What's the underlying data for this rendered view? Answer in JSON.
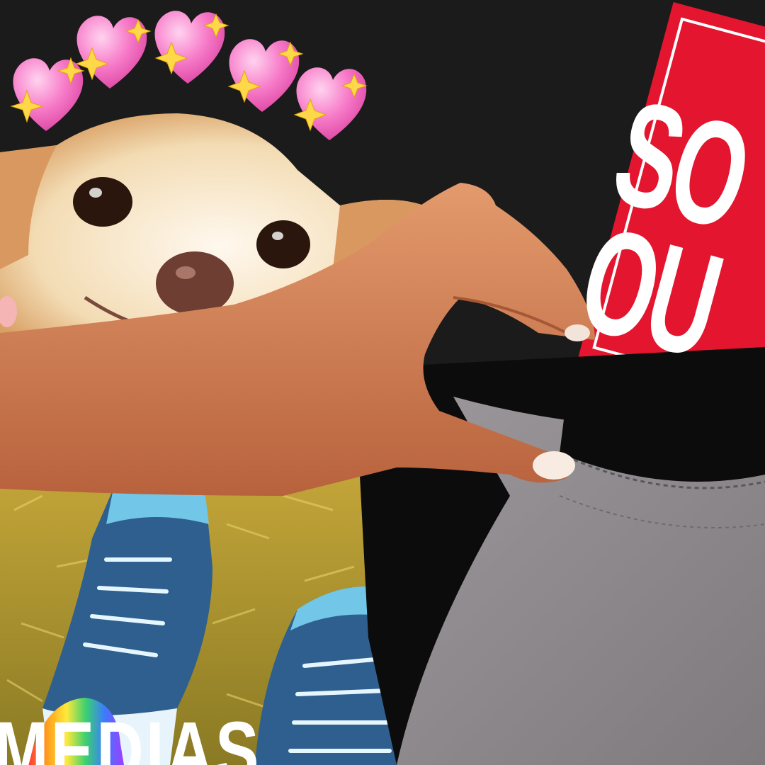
{
  "image": {
    "caption_text": "MEDIAS",
    "sign_text_lines": [
      "SO",
      "OU"
    ],
    "colors": {
      "background": "#1b1b1b",
      "sign_red": "#e4152e",
      "shirt_gray": "#8e8a8e",
      "shirt_black": "#0c0c0c",
      "grass": "#b59a2c",
      "sneaker_blue": "#2e5f8e",
      "skin": "#d9865c",
      "dog_fur": "#f1d7a8",
      "heart_pink": "#f77bc9",
      "sparkle_yellow": "#ffd84a"
    },
    "elements": [
      "heart-emoji-row",
      "sparkle-emoji",
      "chihuahua-photo",
      "hand-photo",
      "red-sign",
      "tshirt-photo",
      "sneakers-photo",
      "rainbow-sock"
    ]
  }
}
